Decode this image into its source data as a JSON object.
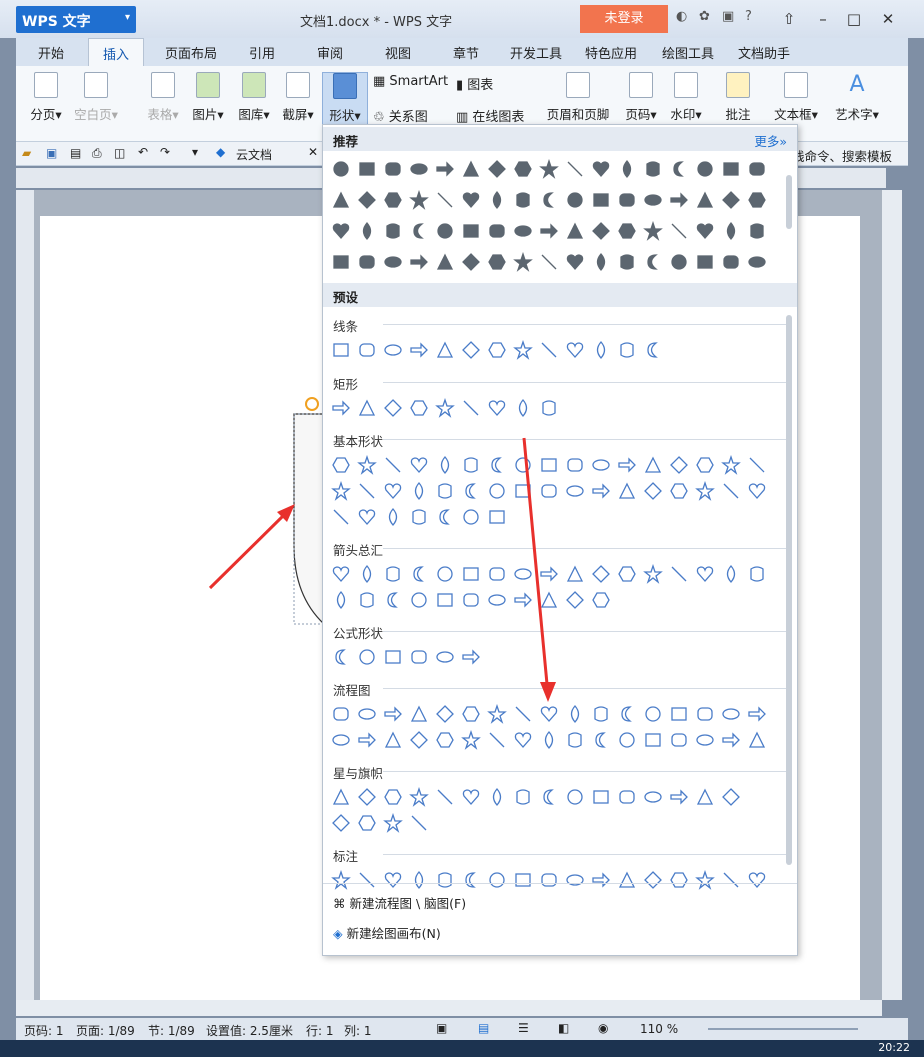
{
  "app": {
    "title": "WPS 文字",
    "doc_title": "文档1.docx * - WPS 文字",
    "login": "未登录"
  },
  "tabs": [
    "开始",
    "插入",
    "页面布局",
    "引用",
    "审阅",
    "视图",
    "章节",
    "开发工具",
    "特色应用",
    "绘图工具",
    "文档助手"
  ],
  "active_tab": "插入",
  "ribbon": {
    "pagebreak": "分页",
    "blankpage": "空白页",
    "table": "表格",
    "picture": "图片",
    "gallery": "图库",
    "screenshot": "截屏",
    "shape": "形状",
    "smartart": "SmartArt",
    "chart": "图表",
    "relation": "关系图",
    "online_chart": "在线图表",
    "header_footer": "页眉和页脚",
    "page_number": "页码",
    "watermark": "水印",
    "comment": "批注",
    "textbox": "文本框",
    "wordart": "艺术字"
  },
  "qbar": {
    "cloud": "云文档",
    "right_text": "线命令、搜索模板"
  },
  "panel": {
    "recommended": "推荐",
    "more": "更多»",
    "preset": "预设",
    "categories": [
      "线条",
      "矩形",
      "基本形状",
      "箭头总汇",
      "公式形状",
      "流程图",
      "星与旗帜",
      "标注"
    ],
    "new_flowchart": "新建流程图 \\ 脑图(F)",
    "new_canvas": "新建绘图画布(N)"
  },
  "status": {
    "page": "页码: 1",
    "pages": "页面: 1/89",
    "section": "节: 1/89",
    "setting": "设置值: 2.5厘米",
    "row": "行: 1",
    "col": "列: 1",
    "zoom": "110 %"
  },
  "taskbar": {
    "time": "20:22"
  },
  "colors": {
    "accent": "#1f6fd0",
    "login": "#f2744e",
    "arrow": "#e8302c"
  }
}
